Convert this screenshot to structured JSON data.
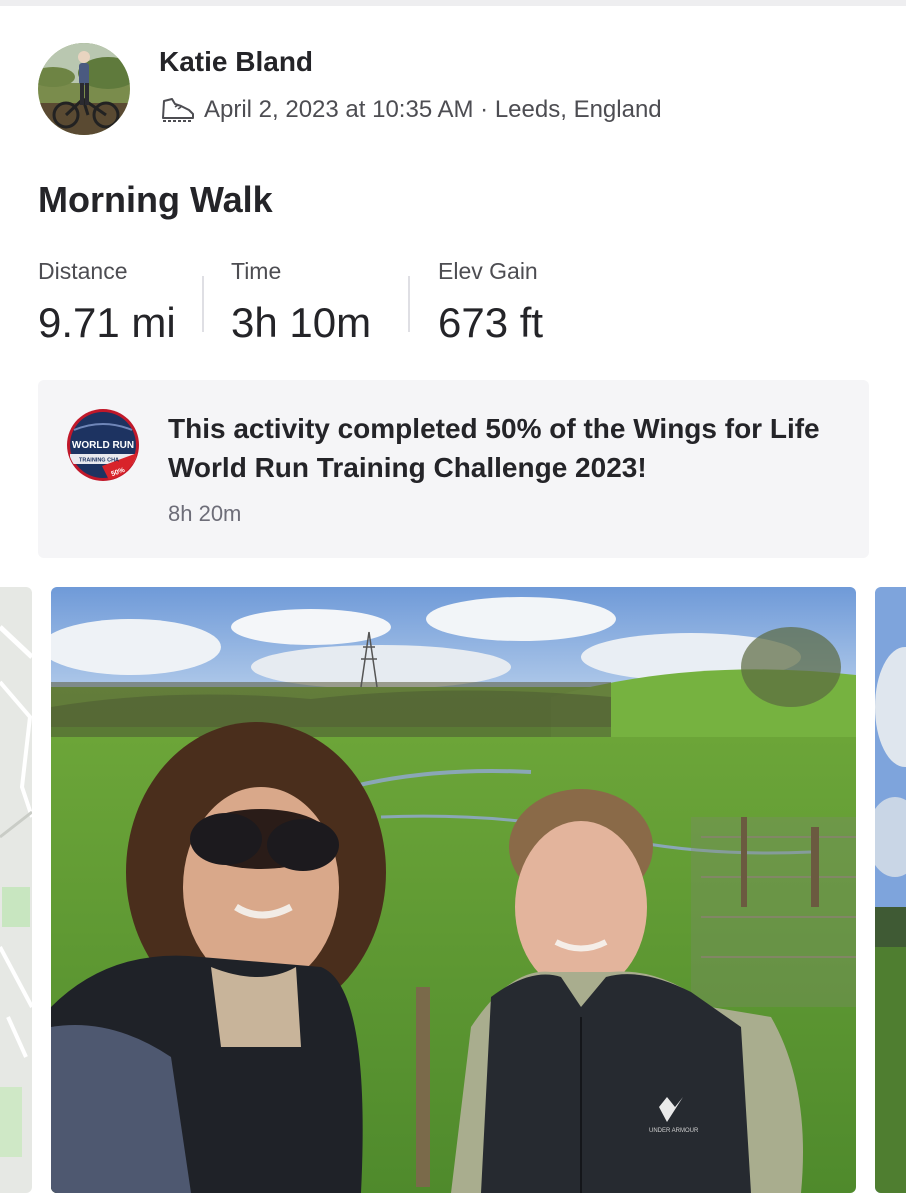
{
  "activity": {
    "athlete_name": "Katie Bland",
    "activity_icon": "walking-shoe-icon",
    "meta": "April 2, 2023 at 10:35 AM · Leeds, England",
    "title": "Morning Walk"
  },
  "stats": [
    {
      "label": "Distance",
      "value": "9.71 mi"
    },
    {
      "label": "Time",
      "value": "3h 10m"
    },
    {
      "label": "Elev Gain",
      "value": "673 ft"
    }
  ],
  "challenge": {
    "badge_icon": "challenge-badge-icon",
    "badge_text": "WORLD RUN",
    "badge_subtext": "TRAINING CHA",
    "badge_percent": "50%",
    "text": "This activity completed 50% of the Wings for Life World Run Training Challenge 2023!",
    "duration": "8h 20m"
  },
  "media": {
    "brand_logo_text": "UNDER ARMOUR"
  },
  "colors": {
    "text_primary": "#242428",
    "text_secondary": "#4d4d52",
    "card_background": "#f5f5f7",
    "badge_navy": "#1d3361",
    "badge_red": "#d8232a"
  }
}
